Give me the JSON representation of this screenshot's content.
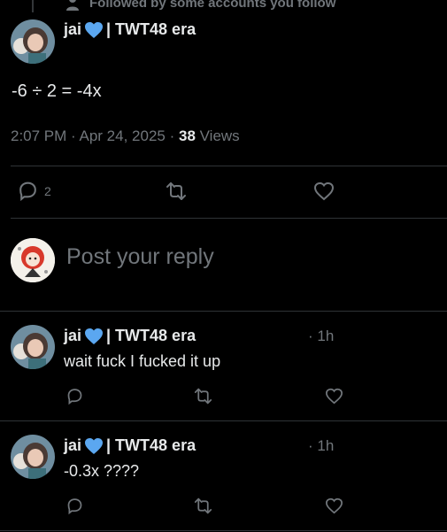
{
  "context": {
    "text": "Followed by some accounts you follow",
    "icon": "person-icon"
  },
  "tweet": {
    "author_name": "jai",
    "author_suffix": "| TWT48 era",
    "badge_icon": "blue-heart-icon",
    "text": "-6 ÷ 2 = -4x",
    "time": "2:07 PM",
    "date": "Apr 24, 2025",
    "views_count": "38",
    "views_label": "Views",
    "reply_count": "2"
  },
  "composer": {
    "placeholder": "Post your reply"
  },
  "replies": [
    {
      "author_name": "jai",
      "author_suffix": "| TWT48 era",
      "time": "1h",
      "text": "wait fuck I fucked it up"
    },
    {
      "author_name": "jai",
      "author_suffix": "| TWT48 era",
      "time": "1h",
      "text": "-0.3x ????"
    }
  ],
  "colors": {
    "background": "#000000",
    "primary_text": "#e7e9ea",
    "secondary_text": "#71767b",
    "divider": "#2f3336",
    "heart_blue": "#5ba7f0"
  }
}
